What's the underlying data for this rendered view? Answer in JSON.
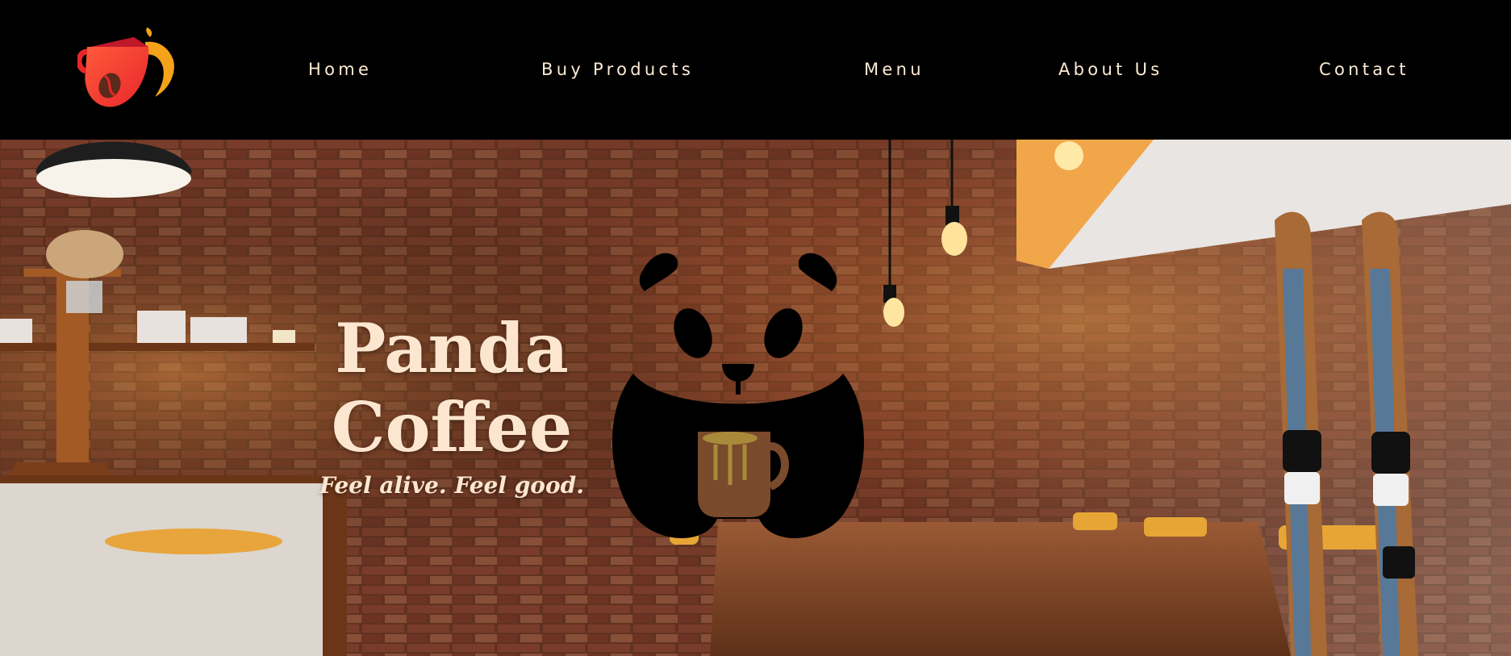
{
  "nav": {
    "logo_icon": "coffee-cup-bean-logo",
    "items": [
      {
        "label": "Home"
      },
      {
        "label": "Buy Products"
      },
      {
        "label": "Menu"
      },
      {
        "label": "About Us"
      },
      {
        "label": "Contact"
      }
    ],
    "text_color": "#fdebd3",
    "background": "#000000"
  },
  "hero": {
    "title_line1": "Panda",
    "title_line2": "Coffee",
    "tagline": "Feel alive. Feel good.",
    "title_color": "#fde6cf",
    "mascot_icon": "panda-coffee-mug-icon",
    "background": "cafe-brick-wall-photo"
  }
}
